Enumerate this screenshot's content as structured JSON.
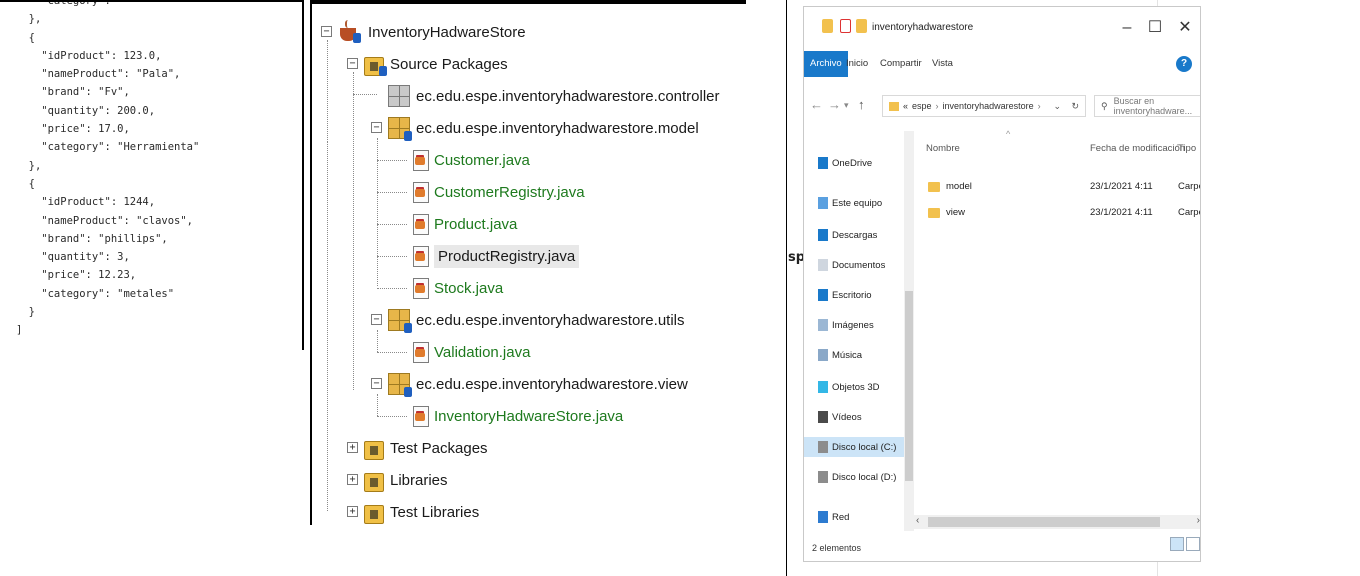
{
  "json_view": {
    "lines": [
      "    \"category\": \"\"",
      "  },",
      "  {",
      "    \"idProduct\": 123.0,",
      "    \"nameProduct\": \"Pala\",",
      "    \"brand\": \"Fv\",",
      "    \"quantity\": 200.0,",
      "    \"price\": 17.0,",
      "    \"category\": \"Herramienta\"",
      "  },",
      "  {",
      "    \"idProduct\": 1244,",
      "    \"nameProduct\": \"clavos\",",
      "    \"brand\": \"phillips\",",
      "    \"quantity\": 3,",
      "    \"price\": 12.23,",
      "    \"category\": \"metales\"",
      "  }",
      "]"
    ]
  },
  "project_tree": {
    "project": "InventoryHadwareStore",
    "source_packages": "Source Packages",
    "pkg_controller": "ec.edu.espe.inventoryhadwarestore.controller",
    "pkg_model": "ec.edu.espe.inventoryhadwarestore.model",
    "model_files": [
      "Customer.java",
      "CustomerRegistry.java",
      "Product.java",
      "ProductRegistry.java",
      "Stock.java"
    ],
    "pkg_utils": "ec.edu.espe.inventoryhadwarestore.utils",
    "utils_files": [
      "Validation.java"
    ],
    "pkg_view": "ec.edu.espe.inventoryhadwarestore.view",
    "view_files": [
      "InventoryHadwareStore.java"
    ],
    "test_packages": "Test Packages",
    "libraries": "Libraries",
    "test_libraries": "Test Libraries",
    "selected_file": "ProductRegistry.java"
  },
  "explorer": {
    "title": "inventoryhadwarestore",
    "ribbon_tabs": [
      "Archivo",
      "Inicio",
      "Compartir",
      "Vista"
    ],
    "path_prefix": "«",
    "path": [
      "espe",
      "inventoryhadwarestore"
    ],
    "search_placeholder": "Buscar en inventoryhadware...",
    "nav_items": [
      {
        "label": "OneDrive",
        "icon": "cloud-icon"
      },
      {
        "label": "Este equipo",
        "icon": "computer-icon"
      },
      {
        "label": "Descargas",
        "icon": "download-icon"
      },
      {
        "label": "Documentos",
        "icon": "document-icon"
      },
      {
        "label": "Escritorio",
        "icon": "desktop-icon"
      },
      {
        "label": "Imágenes",
        "icon": "image-icon"
      },
      {
        "label": "Música",
        "icon": "music-icon"
      },
      {
        "label": "Objetos 3D",
        "icon": "cube-icon"
      },
      {
        "label": "Vídeos",
        "icon": "video-icon"
      },
      {
        "label": "Disco local (C:)",
        "icon": "drive-icon"
      },
      {
        "label": "Disco local (D:)",
        "icon": "drive-icon"
      },
      {
        "label": "Red",
        "icon": "network-icon"
      }
    ],
    "selected_nav": "Disco local (C:)",
    "columns": {
      "name": "Nombre",
      "modified": "Fecha de modificación",
      "type": "Tipo"
    },
    "files": [
      {
        "name": "model",
        "modified": "23/1/2021 4:11",
        "type": "Carpeta de arch"
      },
      {
        "name": "view",
        "modified": "23/1/2021 4:11",
        "type": "Carpeta de arch"
      }
    ],
    "status": "2 elementos"
  },
  "stray_text": "sp",
  "colors": {
    "accent_blue": "#1979ca",
    "java_green": "#1e7a1e",
    "folder_yellow": "#f2c14e",
    "selection_blue": "#cce4f7"
  }
}
